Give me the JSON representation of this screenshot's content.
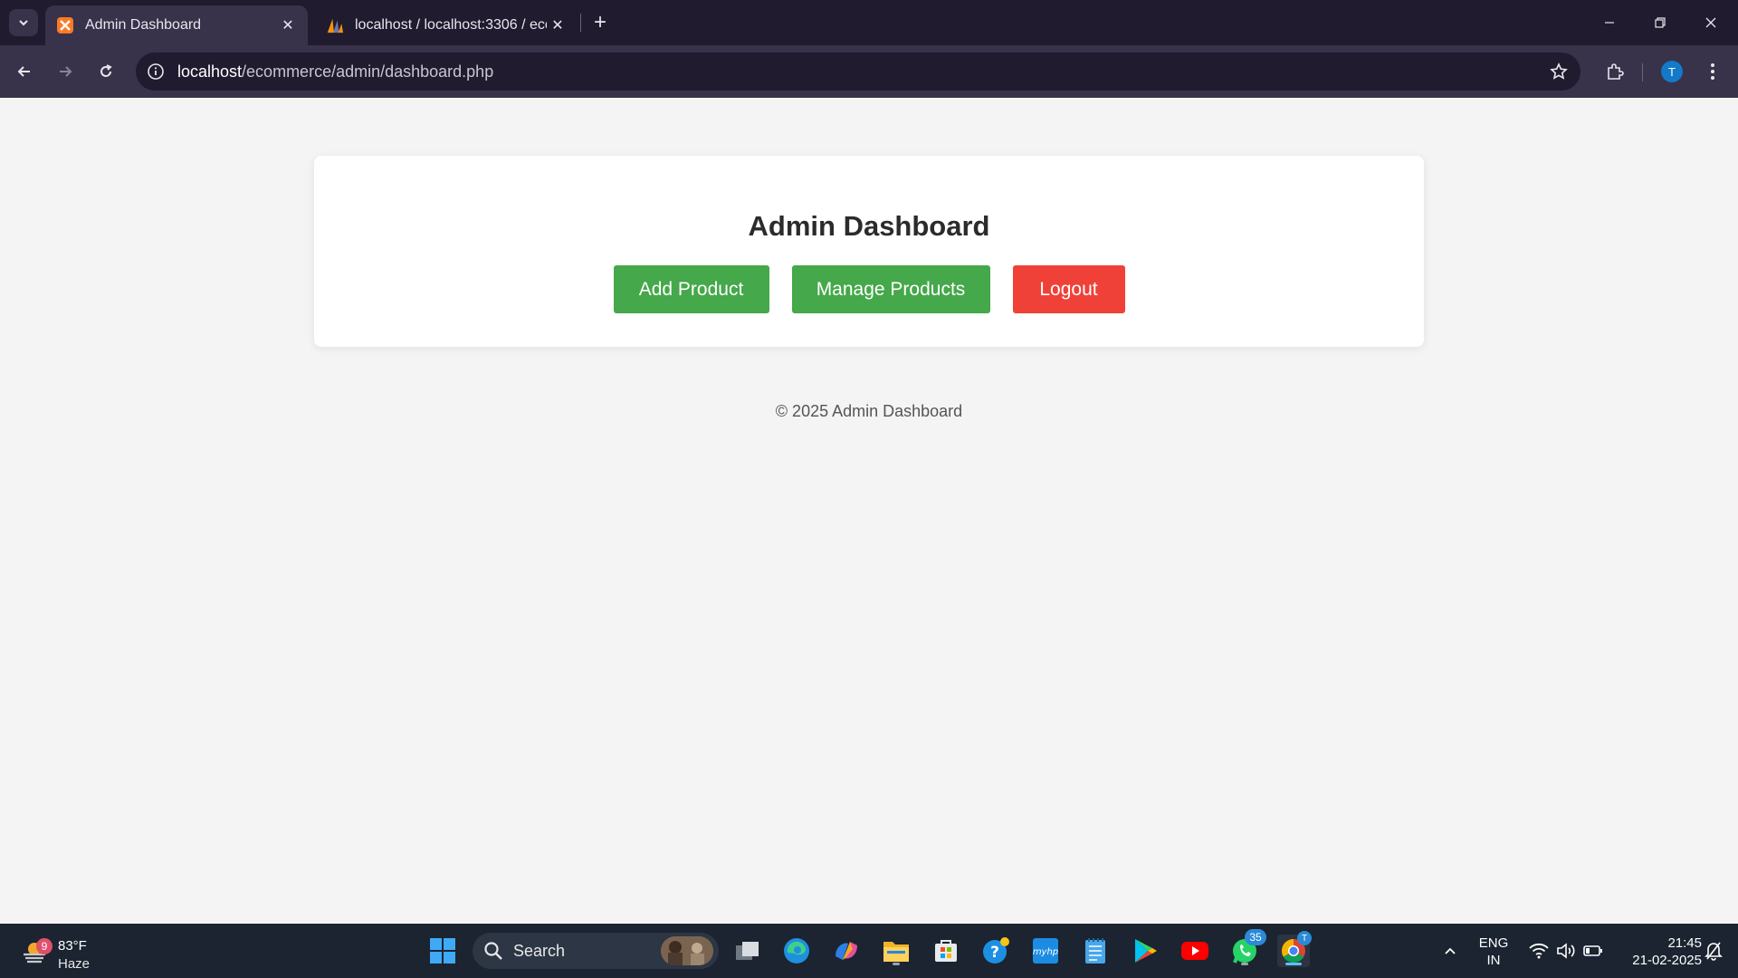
{
  "browser": {
    "tabs": [
      {
        "title": "Admin Dashboard",
        "active": true
      },
      {
        "title": "localhost / localhost:3306 / eco",
        "active": false
      }
    ],
    "url_host": "localhost",
    "url_path": "/ecommerce/admin/dashboard.php",
    "profile_initial": "T"
  },
  "page": {
    "heading": "Admin Dashboard",
    "buttons": {
      "add_product": "Add Product",
      "manage_products": "Manage Products",
      "logout": "Logout"
    },
    "footer": "© 2025 Admin Dashboard",
    "colors": {
      "green": "#45a84a",
      "red": "#ef4137"
    }
  },
  "taskbar": {
    "weather_badge": "9",
    "weather_temp": "83°F",
    "weather_condition": "Haze",
    "search_label": "Search",
    "whatsapp_badge": "35",
    "chrome_badge": "T",
    "language_line1": "ENG",
    "language_line2": "IN",
    "time": "21:45",
    "date": "21-02-2025"
  }
}
